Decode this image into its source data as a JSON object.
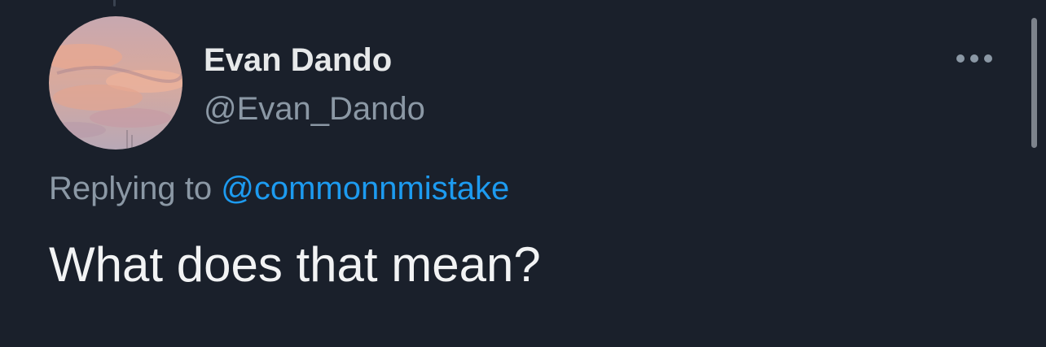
{
  "tweet": {
    "author": {
      "display_name": "Evan Dando",
      "handle": "@Evan_Dando",
      "avatar_icon": "avatar-sunset-clouds"
    },
    "reply": {
      "prefix": "Replying to",
      "target_handle": "@commonnmistake"
    },
    "text": "What does that mean?",
    "more_icon": "more-horizontal-icon"
  },
  "colors": {
    "background": "#1a202b",
    "primary_text": "#e7e9ea",
    "secondary_text": "#8b98a5",
    "link": "#1d9bf0"
  }
}
